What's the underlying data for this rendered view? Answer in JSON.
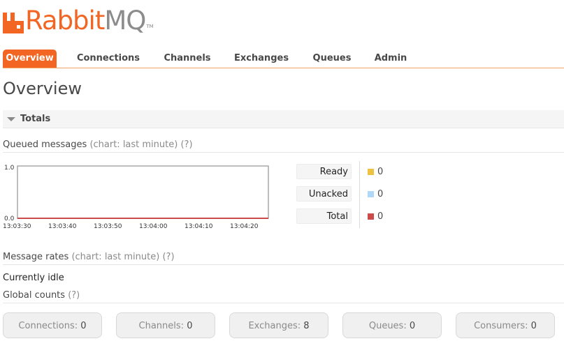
{
  "logo": {
    "rabbit": "Rabbit",
    "mq": "MQ",
    "tm": "TM"
  },
  "nav": {
    "tabs": [
      {
        "label": "Overview",
        "active": true
      },
      {
        "label": "Connections"
      },
      {
        "label": "Channels"
      },
      {
        "label": "Exchanges"
      },
      {
        "label": "Queues"
      },
      {
        "label": "Admin"
      }
    ]
  },
  "page": {
    "title": "Overview"
  },
  "totals": {
    "title": "Totals"
  },
  "queued": {
    "label": "Queued messages",
    "hint": "(chart: last minute)",
    "help": "(?)"
  },
  "chart_data": {
    "type": "line",
    "x": [
      "13:03:30",
      "13:03:40",
      "13:03:50",
      "13:04:00",
      "13:04:10",
      "13:04:20"
    ],
    "yticks": [
      "1.0",
      "0.0"
    ],
    "ylim": [
      0,
      1
    ],
    "series": [
      {
        "name": "Ready",
        "color": "#edc240",
        "values": [
          0,
          0,
          0,
          0,
          0,
          0
        ]
      },
      {
        "name": "Unacked",
        "color": "#afd8f8",
        "values": [
          0,
          0,
          0,
          0,
          0,
          0
        ]
      },
      {
        "name": "Total",
        "color": "#cb4b4b",
        "values": [
          0,
          0,
          0,
          0,
          0,
          0
        ]
      }
    ]
  },
  "legend": [
    {
      "label": "Ready",
      "value": "0",
      "color": "#edc240"
    },
    {
      "label": "Unacked",
      "value": "0",
      "color": "#afd8f8"
    },
    {
      "label": "Total",
      "value": "0",
      "color": "#cb4b4b"
    }
  ],
  "rates": {
    "label": "Message rates",
    "hint": "(chart: last minute)",
    "help": "(?)",
    "status": "Currently idle"
  },
  "global": {
    "label": "Global counts",
    "help": "(?)",
    "counts": [
      {
        "label": "Connections:",
        "value": "0"
      },
      {
        "label": "Channels:",
        "value": "0"
      },
      {
        "label": "Exchanges:",
        "value": "8"
      },
      {
        "label": "Queues:",
        "value": "0"
      },
      {
        "label": "Consumers:",
        "value": "0"
      }
    ]
  },
  "colors": {
    "accent": "#f26522"
  }
}
